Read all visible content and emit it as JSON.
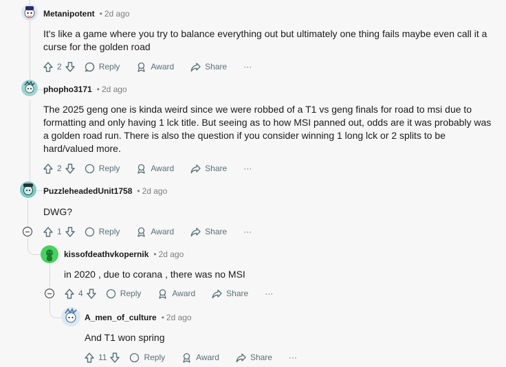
{
  "comments": [
    {
      "username": "Metanipotent",
      "time": "2d ago",
      "lines": [
        "It's like a game where you try to balance everything out but ultimately one thing fails maybe even call it a",
        "curse for the golden road"
      ],
      "votes": "2",
      "reply_label": "Reply",
      "award_label": "Award",
      "share_label": "Share",
      "more_label": "···"
    },
    {
      "username": "phopho3171",
      "time": "2d ago",
      "lines": [
        "The 2025 geng one is kinda weird since we were robbed of a T1 vs geng finals for road to msi due to",
        "formatting and only having 1 lck title. But seeing as to how MSI panned out, odds are it was probably was",
        "a golden road run. There is also the question if you consider winning 1 long lck or 2 splits to be",
        "hard/valued more."
      ],
      "votes": "2",
      "reply_label": "Reply",
      "award_label": "Award",
      "share_label": "Share",
      "more_label": "···"
    },
    {
      "username": "PuzzleheadedUnit1758",
      "time": "2d ago",
      "lines": [
        "DWG?"
      ],
      "votes": "1",
      "reply_label": "Reply",
      "award_label": "Award",
      "share_label": "Share",
      "more_label": "···"
    },
    {
      "username": "kissofdeathvkopernik",
      "time": "2d ago",
      "lines": [
        "in 2020 , due to corana , there was no MSI"
      ],
      "votes": "4",
      "reply_label": "Reply",
      "award_label": "Award",
      "share_label": "Share",
      "more_label": "···"
    },
    {
      "username": "A_men_of_culture",
      "time": "2d ago",
      "lines": [
        "And T1 won spring"
      ],
      "votes": "11",
      "reply_label": "Reply",
      "award_label": "Award",
      "share_label": "Share",
      "more_label": "···"
    }
  ],
  "separator": "•",
  "colors": {
    "meta": "#7c7c7c",
    "action": "#576f76",
    "thread": "#d6d9dc",
    "avatar_green": "#46d160"
  }
}
